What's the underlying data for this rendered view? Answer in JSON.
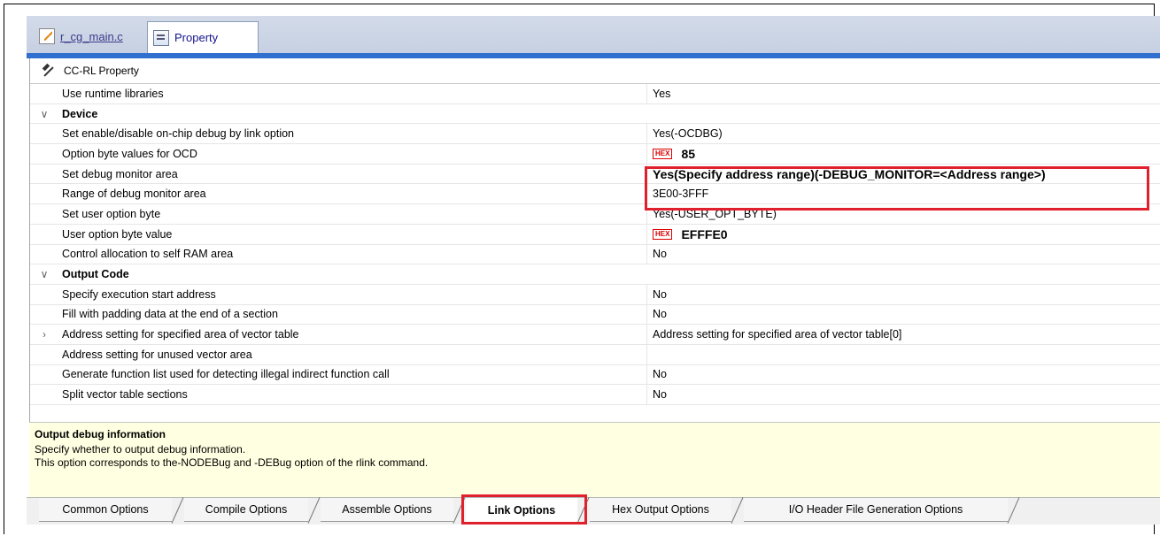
{
  "file_tabs": [
    {
      "label": "r_cg_main.c",
      "icon": "c-file-icon"
    },
    {
      "label": "Property",
      "icon": "property-icon"
    }
  ],
  "panel_title": "CC-RL Property",
  "rows": [
    {
      "type": "prop",
      "name": "Use runtime libraries",
      "value": "Yes"
    },
    {
      "type": "cat",
      "name": "Device",
      "expander": "v"
    },
    {
      "type": "prop",
      "name": "Set enable/disable on-chip debug by link option",
      "value": "Yes(-OCDBG)"
    },
    {
      "type": "prop",
      "name": "Option byte values for OCD",
      "value": "85",
      "hex": true
    },
    {
      "type": "prop",
      "name": "Set debug monitor area",
      "value": "Yes(Specify address range)(-DEBUG_MONITOR=<Address range>)",
      "bold": true
    },
    {
      "type": "prop",
      "name": "Range of debug monitor area",
      "value": "3E00-3FFF"
    },
    {
      "type": "prop",
      "name": "Set user option byte",
      "value": "Yes(-USER_OPT_BYTE)"
    },
    {
      "type": "prop",
      "name": "User option byte value",
      "value": "EFFFE0",
      "hex": true
    },
    {
      "type": "prop",
      "name": "Control allocation to self RAM area",
      "value": "No"
    },
    {
      "type": "cat",
      "name": "Output Code",
      "expander": "v"
    },
    {
      "type": "prop",
      "name": "Specify execution start address",
      "value": "No"
    },
    {
      "type": "prop",
      "name": "Fill with padding data at the end of a section",
      "value": "No"
    },
    {
      "type": "prop",
      "name": "Address setting for specified area of vector table",
      "value": "Address setting for specified area of vector table[0]",
      "expander": ">"
    },
    {
      "type": "prop",
      "name": "Address setting for unused vector area",
      "value": ""
    },
    {
      "type": "prop",
      "name": "Generate function list used for detecting illegal indirect function call",
      "value": "No"
    },
    {
      "type": "prop",
      "name": "Split vector table sections",
      "value": "No"
    }
  ],
  "hex_badge": "HEX",
  "description": {
    "title": "Output debug information",
    "line1": "Specify whether to output debug information.",
    "line2": "This option corresponds to the-NODEBug and -DEBug option of the rlink command."
  },
  "bottom_tabs": [
    "Common Options",
    "Compile Options",
    "Assemble Options",
    "Link Options",
    "Hex Output Options",
    "I/O Header File Generation Options"
  ],
  "selected_tab": "Link Options"
}
